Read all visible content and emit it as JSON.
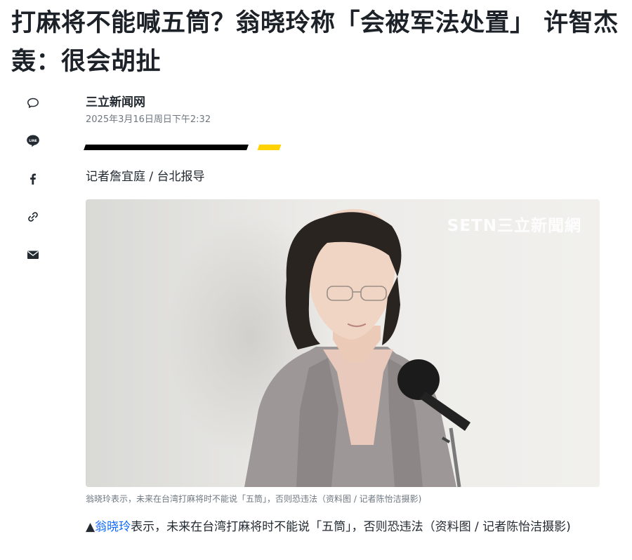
{
  "article": {
    "headline": "打麻将不能喊五筒？翁晓玲称「会被军法处置」 许智杰轰：很会胡扯",
    "provider": "三立新闻网",
    "timestamp": "2025年3月16日周日下午2:32",
    "reporter": "记者詹宜庭 / 台北报导",
    "image": {
      "watermark": "SETN三立新聞網",
      "caption": "翁晓玲表示，未来在台湾打麻将时不能说「五筒」，否则恐违法（资料图 / 记者陈怡洁摄影)"
    },
    "body": {
      "prefix": "▲",
      "link_text": "翁晓玲",
      "text": "表示，未来在台湾打麻将时不能说「五筒」，否则恐违法（资料图 / 记者陈怡洁摄影)"
    }
  },
  "share_rail": {
    "icons": [
      "comment-icon",
      "line-icon",
      "facebook-icon",
      "link-icon",
      "mail-icon"
    ],
    "line_label": "LINE"
  },
  "colors": {
    "accent_yellow": "#ffd200",
    "link": "#0f69ff",
    "text": "#232a31",
    "muted": "#6e7780"
  }
}
